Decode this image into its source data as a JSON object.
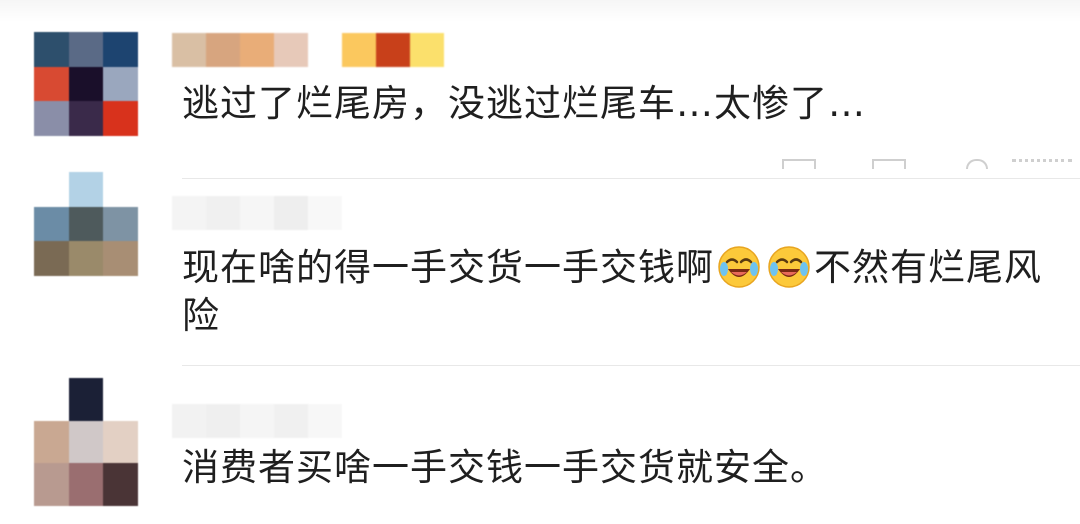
{
  "comments": [
    {
      "text": "逃过了烂尾房，没逃过烂尾车…太惨了…",
      "avatar_colors": [
        "#2d4f6c",
        "#5a6a86",
        "#1d4470",
        "#d84a32",
        "#1a0f2a",
        "#9aa7be",
        "#8a8ea8",
        "#3a2a4a",
        "#d8321c"
      ],
      "username_colors": [
        "#d9bfa4",
        "#d7a57f",
        "#e9ad78",
        "#e7c9b9",
        "#ffffff",
        "#fbc85e",
        "#c8401a",
        "#fbe06c"
      ]
    },
    {
      "text_before": "现在啥的得一手交货一手交钱啊",
      "emoji": [
        "laughing-crying-emoji",
        "laughing-crying-emoji"
      ],
      "text_after": "不然有烂尾风险",
      "avatar_colors": [
        "#ffffff",
        "#b3d2e6",
        "#ffffff",
        "#6b8ca6",
        "#4e5a5c",
        "#7e93a4",
        "#7a6a54",
        "#9a8a6a",
        "#a88e74"
      ],
      "username_colors": [
        "#f4f4f4",
        "#f0f0f0",
        "#f6f6f6",
        "#eeeeee",
        "#f8f8f8"
      ]
    },
    {
      "text": "消费者买啥一手交钱一手交货就安全。",
      "avatar_colors": [
        "#ffffff",
        "#1b2036",
        "#ffffff",
        "#c9a892",
        "#d0c8c8",
        "#e3d0c4",
        "#b89a90",
        "#9a6e70",
        "#4a3436"
      ],
      "username_colors": [
        "#f2f2f2",
        "#efefef",
        "#f5f5f5",
        "#f0f0f0",
        "#f7f7f7"
      ]
    }
  ]
}
